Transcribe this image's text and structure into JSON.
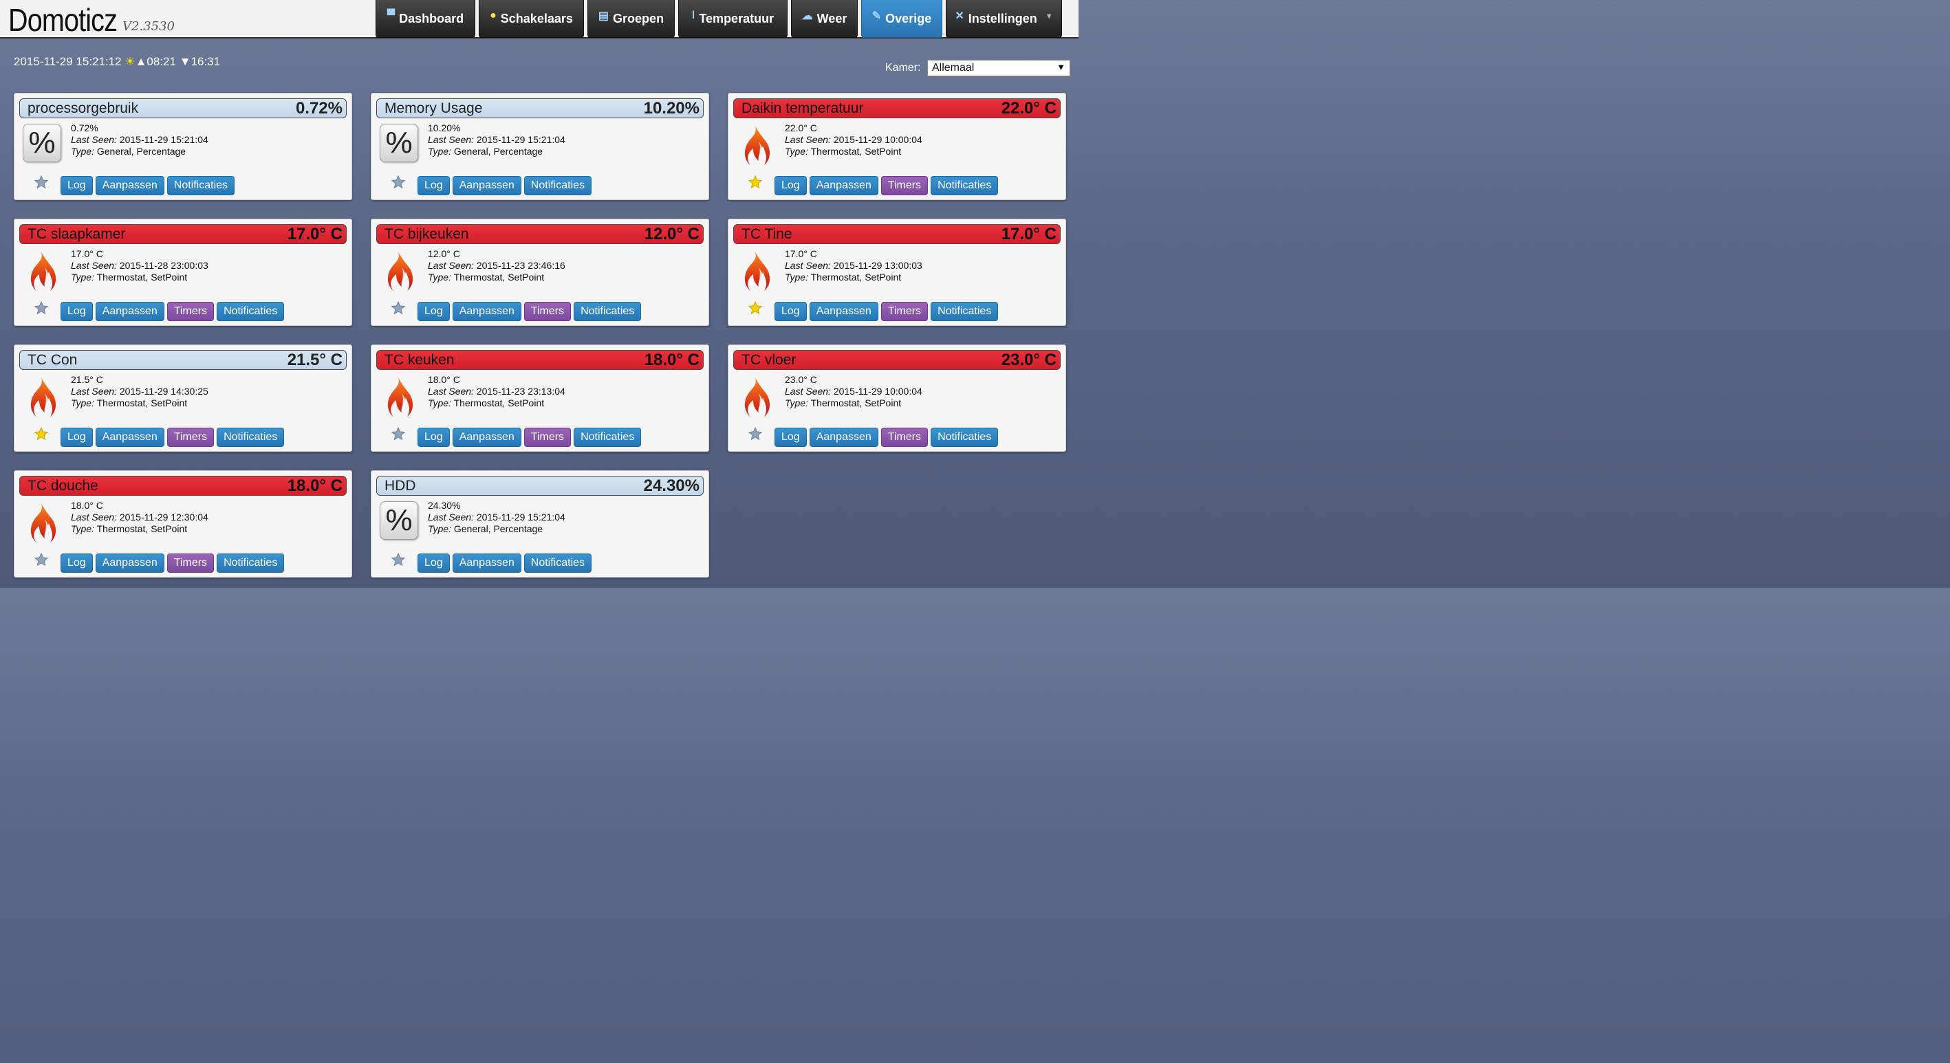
{
  "app": {
    "title": "Domoticz",
    "version": "V2.3530"
  },
  "nav": [
    {
      "label": "Dashboard",
      "icon": "monitor-icon"
    },
    {
      "label": "Schakelaars",
      "icon": "bulb-icon"
    },
    {
      "label": "Groepen",
      "icon": "clapper-icon"
    },
    {
      "label": "Temperatuur",
      "icon": "thermometer-icon"
    },
    {
      "label": "Weer",
      "icon": "cloud-icon"
    },
    {
      "label": "Overige",
      "icon": "utility-icon",
      "active": true
    },
    {
      "label": "Instellingen",
      "icon": "tools-icon"
    }
  ],
  "status": {
    "datetime": "2015-11-29 15:21:12",
    "sunrise": "▲08:21",
    "sunset": "▼16:31"
  },
  "room": {
    "label": "Kamer:",
    "selected": "Allemaal"
  },
  "labels": {
    "last_seen": "Last Seen:",
    "type": "Type:",
    "log": "Log",
    "edit": "Aanpassen",
    "timers": "Timers",
    "notifications": "Notificaties"
  },
  "devices": [
    {
      "name": "processorgebruik",
      "value": "0.72%",
      "data": "0.72%",
      "last_seen": "2015-11-29 15:21:04",
      "type": "General, Percentage",
      "style": "blue",
      "icon": "percent-icon",
      "favorite": false,
      "timers": false
    },
    {
      "name": "Memory Usage",
      "value": "10.20%",
      "data": "10.20%",
      "last_seen": "2015-11-29 15:21:04",
      "type": "General, Percentage",
      "style": "blue",
      "icon": "percent-icon",
      "favorite": false,
      "timers": false
    },
    {
      "name": "Daikin temperatuur",
      "value": "22.0° C",
      "data": "22.0° C",
      "last_seen": "2015-11-29 10:00:04",
      "type": "Thermostat, SetPoint",
      "style": "red",
      "icon": "flame-icon",
      "favorite": true,
      "timers": true
    },
    {
      "name": "TC slaapkamer",
      "value": "17.0° C",
      "data": "17.0° C",
      "last_seen": "2015-11-28 23:00:03",
      "type": "Thermostat, SetPoint",
      "style": "red",
      "icon": "flame-icon",
      "favorite": false,
      "timers": true
    },
    {
      "name": "TC bijkeuken",
      "value": "12.0° C",
      "data": "12.0° C",
      "last_seen": "2015-11-23 23:46:16",
      "type": "Thermostat, SetPoint",
      "style": "red",
      "icon": "flame-icon",
      "favorite": false,
      "timers": true
    },
    {
      "name": "TC Tine",
      "value": "17.0° C",
      "data": "17.0° C",
      "last_seen": "2015-11-29 13:00:03",
      "type": "Thermostat, SetPoint",
      "style": "red",
      "icon": "flame-icon",
      "favorite": true,
      "timers": true
    },
    {
      "name": "TC Con",
      "value": "21.5° C",
      "data": "21.5° C",
      "last_seen": "2015-11-29 14:30:25",
      "type": "Thermostat, SetPoint",
      "style": "blue",
      "icon": "flame-icon",
      "favorite": true,
      "timers": true
    },
    {
      "name": "TC keuken",
      "value": "18.0° C",
      "data": "18.0° C",
      "last_seen": "2015-11-23 23:13:04",
      "type": "Thermostat, SetPoint",
      "style": "red",
      "icon": "flame-icon",
      "favorite": false,
      "timers": true
    },
    {
      "name": "TC vloer",
      "value": "23.0° C",
      "data": "23.0° C",
      "last_seen": "2015-11-29 10:00:04",
      "type": "Thermostat, SetPoint",
      "style": "red",
      "icon": "flame-icon",
      "favorite": false,
      "timers": true
    },
    {
      "name": "TC douche",
      "value": "18.0° C",
      "data": "18.0° C",
      "last_seen": "2015-11-29 12:30:04",
      "type": "Thermostat, SetPoint",
      "style": "red",
      "icon": "flame-icon",
      "favorite": false,
      "timers": true
    },
    {
      "name": "HDD",
      "value": "24.30%",
      "data": "24.30%",
      "last_seen": "2015-11-29 15:21:04",
      "type": "General, Percentage",
      "style": "blue",
      "icon": "percent-icon",
      "favorite": false,
      "timers": false
    }
  ],
  "colors": {
    "accent": "#2a7fc0",
    "alert": "#d9232d",
    "timers": "#8150a8",
    "favorite": "#f5d000"
  }
}
